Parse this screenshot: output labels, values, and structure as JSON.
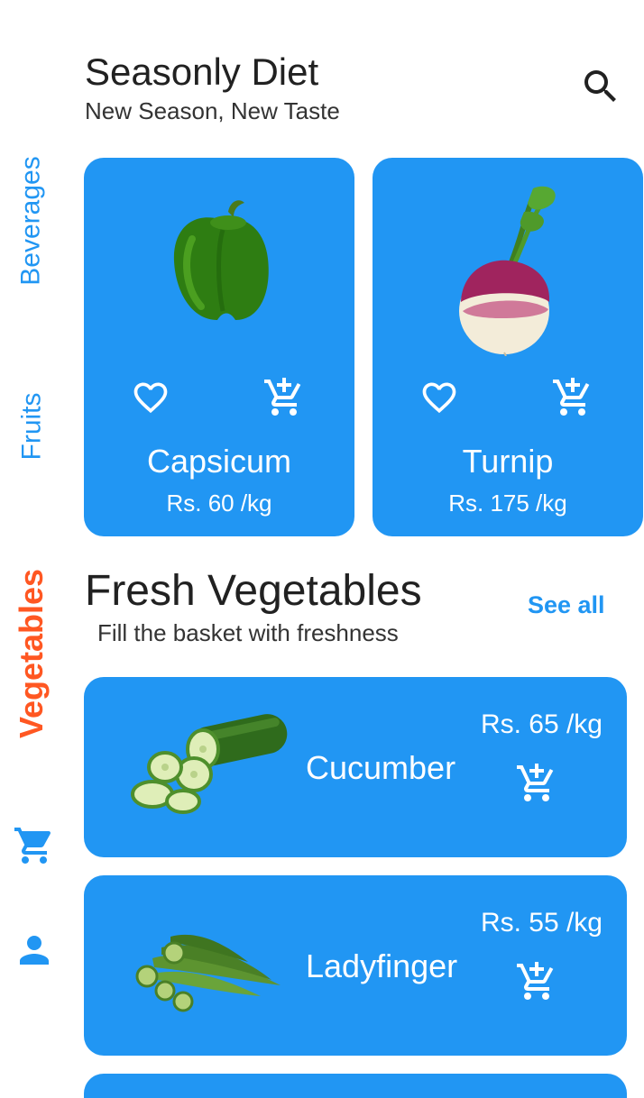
{
  "colors": {
    "primary": "#2196F3",
    "accent_active": "#FF5722",
    "rail_inactive": "#2196F3",
    "see_all": "#2196F3",
    "text_dark": "#212121",
    "card_text": "#FFFFFF"
  },
  "header": {
    "title": "Seasonly Diet",
    "subtitle": "New Season, New Taste",
    "search_icon": "search-icon"
  },
  "sidebar": {
    "items": [
      {
        "label": "Beverages",
        "active": false
      },
      {
        "label": "Fruits",
        "active": false
      },
      {
        "label": "Vegetables",
        "active": true
      }
    ],
    "cart_icon": "cart-icon",
    "profile_icon": "person-icon"
  },
  "seasonal": [
    {
      "name": "Capsicum",
      "price": "Rs. 60 /kg",
      "image": "capsicum"
    },
    {
      "name": "Turnip",
      "price": "Rs. 175 /kg",
      "image": "turnip"
    }
  ],
  "section": {
    "title": "Fresh Vegetables",
    "subtitle": "Fill the basket with freshness",
    "see_all": "See all"
  },
  "list": [
    {
      "name": "Cucumber",
      "price": "Rs. 65 /kg",
      "image": "cucumber"
    },
    {
      "name": "Ladyfinger",
      "price": "Rs. 55 /kg",
      "image": "ladyfinger"
    }
  ]
}
